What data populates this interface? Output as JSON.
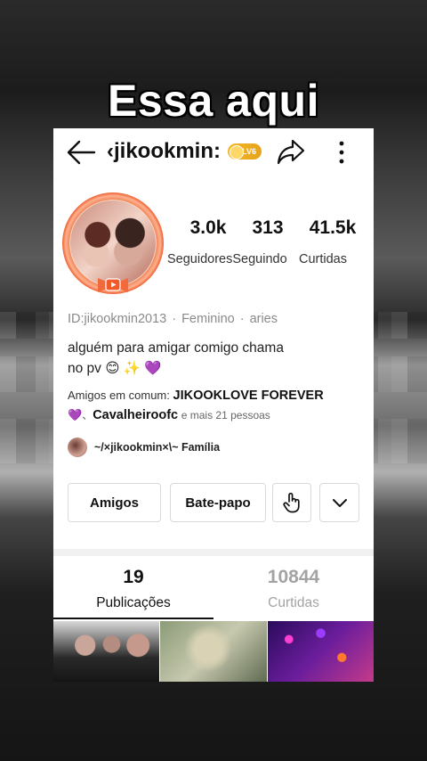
{
  "overlay_caption": "Essa aqui",
  "profile": {
    "handle": "‹jikookmin:",
    "level_badge": "LV6",
    "stats": [
      {
        "value": "3.0k",
        "label": "Seguidores"
      },
      {
        "value": "313",
        "label": "Seguindo"
      },
      {
        "value": "41.5k",
        "label": "Curtidas"
      }
    ],
    "user_id": "ID:jikookmin2013",
    "gender": "Feminino",
    "sign": "aries",
    "bio_line1": "alguém para amigar comigo chama",
    "bio_line2": "no pv 😊 ✨ 💜",
    "mutual_prefix": "Amigos em comum:",
    "mutual_name1": "JIKOOKLOVE FOREVER",
    "mutual_line2_emoji": "💜",
    "mutual_name2": "Cavalheiroofc",
    "mutual_suffix": "e mais 21 pessoas",
    "family_label": "~/×jikookmin×\\~ Família"
  },
  "actions": {
    "friends_label": "Amigos",
    "chat_label": "Bate-papo"
  },
  "tabs": [
    {
      "count": "19",
      "label": "Publicações",
      "active": true
    },
    {
      "count": "10844",
      "label": "Curtidas",
      "active": false
    }
  ],
  "colors": {
    "accent_gold": "#f5b92a",
    "text_dark": "#111111",
    "text_muted": "#8a8a8a"
  }
}
